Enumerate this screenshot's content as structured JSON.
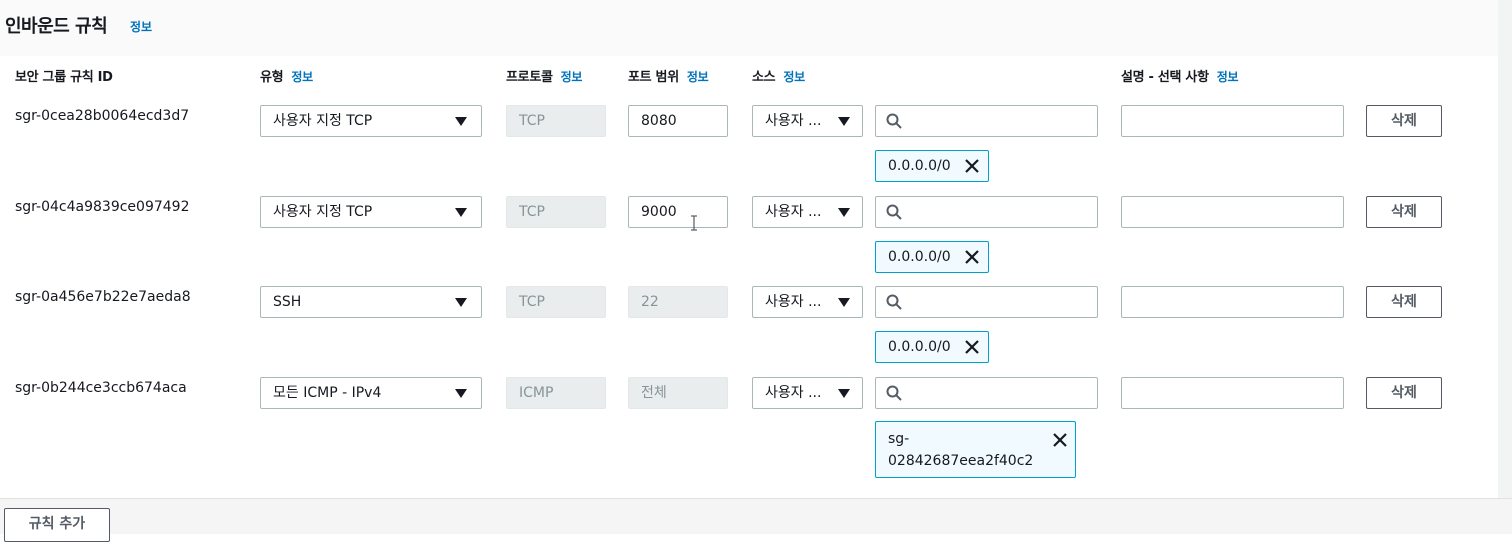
{
  "section": {
    "title": "인바운드 규칙",
    "info": "정보"
  },
  "columns": {
    "rule_id": "보안 그룹 규칙 ID",
    "type": "유형",
    "protocol": "프로토콜",
    "port_range": "포트 범위",
    "source": "소스",
    "description": "설명 - 선택 사항",
    "info": "정보"
  },
  "rules": [
    {
      "id": "sgr-0cea28b0064ecd3d7",
      "type": "사용자 지정 TCP",
      "protocol": "TCP",
      "port": "8080",
      "source": "사용자 ...",
      "search_value": "",
      "token": "0.0.0.0/0",
      "description": "",
      "delete": "삭제"
    },
    {
      "id": "sgr-04c4a9839ce097492",
      "type": "사용자 지정 TCP",
      "protocol": "TCP",
      "port": "9000",
      "source": "사용자 ...",
      "search_value": "",
      "token": "0.0.0.0/0",
      "description": "",
      "delete": "삭제"
    },
    {
      "id": "sgr-0a456e7b22e7aeda8",
      "type": "SSH",
      "protocol": "TCP",
      "port": "22",
      "source": "사용자 ...",
      "search_value": "",
      "token": "0.0.0.0/0",
      "description": "",
      "delete": "삭제"
    },
    {
      "id": "sgr-0b244ce3ccb674aca",
      "type": "모든 ICMP - IPv4",
      "protocol": "ICMP",
      "port": "전체",
      "source": "사용자 ...",
      "search_value": "",
      "token_line1": "sg-",
      "token_line2": "02842687eea2f40c2",
      "description": "",
      "delete": "삭제"
    }
  ],
  "add_rule_button": "규칙 추가",
  "icons": {
    "search": "search-icon",
    "close": "close-icon",
    "caret": "caret-down-icon"
  },
  "colors": {
    "link": "#0073bb",
    "token_border": "#00a1c9",
    "token_bg": "#f1faff",
    "text": "#16191f"
  }
}
